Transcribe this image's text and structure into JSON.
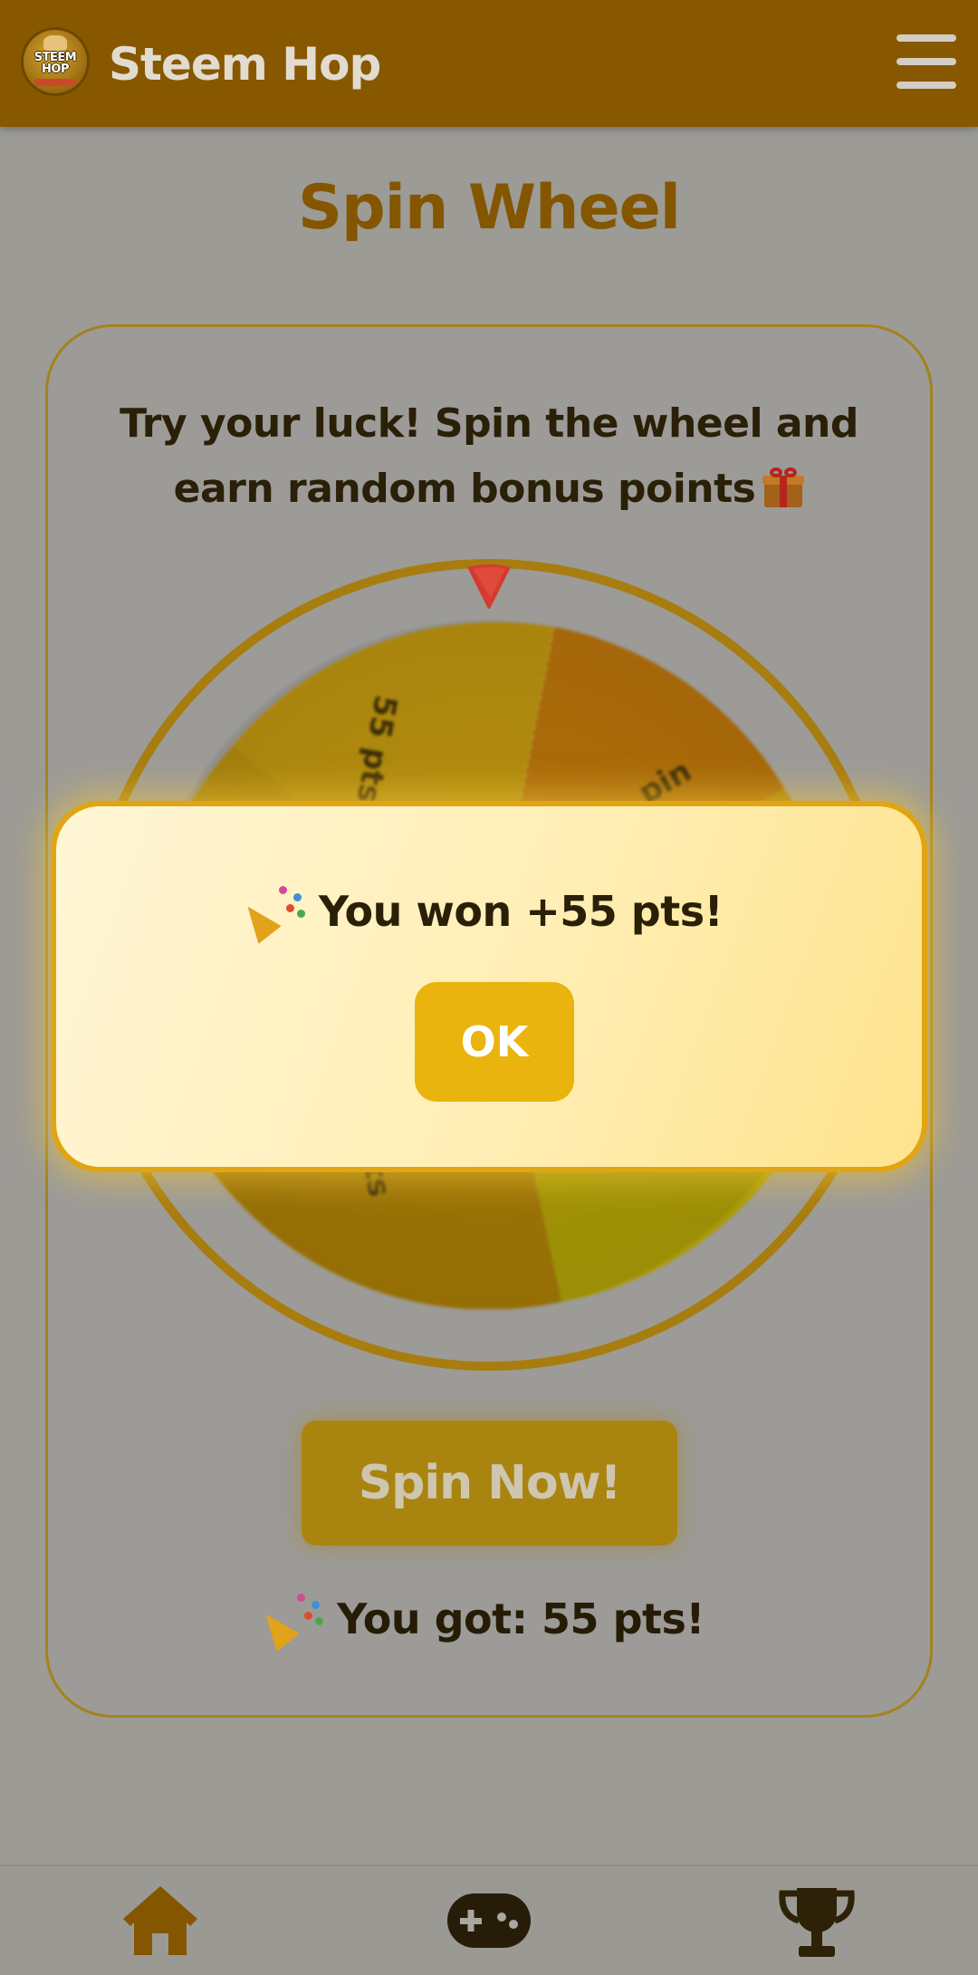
{
  "header": {
    "logo_text": "STEEM HOP",
    "app_title": "Steem Hop",
    "menu_icon": "hamburger-menu-icon"
  },
  "page": {
    "title": "Spin Wheel"
  },
  "card": {
    "description_line1": "Try your luck! Spin the wheel and",
    "description_line2": "earn random bonus points",
    "gift_icon": "gift-icon"
  },
  "wheel": {
    "segment_labels_visible": [
      "55 pts",
      "pin",
      "3 pts"
    ],
    "colors": {
      "ring": "#a87d10",
      "pointer": "#d63a2f",
      "segment_a": "#b8900f",
      "segment_b": "#b3700a",
      "segment_c": "#a27806",
      "segment_d": "#a99a06"
    }
  },
  "spin_button": {
    "label": "Spin Now!"
  },
  "result": {
    "text": "You got: 55 pts!"
  },
  "modal": {
    "message": "You won +55 pts!",
    "ok_label": "OK"
  },
  "bottom_nav": {
    "items": [
      {
        "icon": "home-icon"
      },
      {
        "icon": "gamepad-icon"
      },
      {
        "icon": "trophy-icon"
      }
    ]
  },
  "colors": {
    "header_bg": "#875800",
    "title": "#845600",
    "modal_border": "#e0a512",
    "ok_button": "#e8b40d",
    "overlay_bg": "#9c9b96"
  }
}
